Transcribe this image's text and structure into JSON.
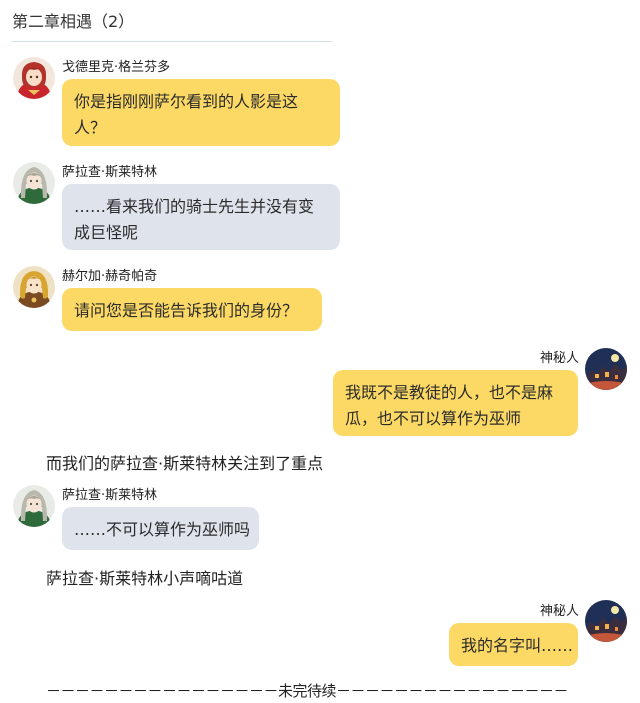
{
  "chapter_title": "第二章相遇（2）",
  "messages": [
    {
      "name": "戈德里克·格兰芬多",
      "text": "你是指刚刚萨尔看到的人影是这人？",
      "line1": "你是指刚刚萨尔看到的人影是这",
      "line2": "人？",
      "bubble_color": "#fcd965",
      "avatar": "red-haired-character-avatar"
    },
    {
      "name": "萨拉查·斯莱特林",
      "text": "……看来我们的骑士先生并没有变成巨怪呢",
      "line1": "……看来我们的骑士先生并没有变",
      "line2": "成巨怪呢",
      "bubble_color": "#dfe3ec",
      "avatar": "silver-haired-character-avatar"
    },
    {
      "name": "赫尔加·赫奇帕奇",
      "text": "请问您是否能告诉我们的身份？",
      "bubble_color": "#fcd965",
      "avatar": "blonde-character-avatar"
    },
    {
      "name": "神秘人",
      "text": "我既不是教徒的人，也不是麻瓜，也不可以算作为巫师",
      "line1": "我既不是教徒的人，也不是麻",
      "line2": "瓜，也不可以算作为巫师",
      "bubble_color": "#fcd965",
      "avatar": "night-scene-avatar"
    },
    {
      "name": "萨拉查·斯莱特林",
      "text": "……不可以算作为巫师吗",
      "bubble_color": "#dfe3ec",
      "avatar": "silver-haired-character-avatar"
    },
    {
      "name": "神秘人",
      "text": "我的名字叫……",
      "bubble_color": "#fcd965",
      "avatar": "night-scene-avatar"
    }
  ],
  "narrations": [
    "而我们的萨拉查·斯莱特林关注到了重点",
    "萨拉查·斯莱特林小声嘀咕道"
  ],
  "end_marker": "－－－－－－－－－－－－－－－－未完待续－－－－－－－－－－－－－－－－"
}
